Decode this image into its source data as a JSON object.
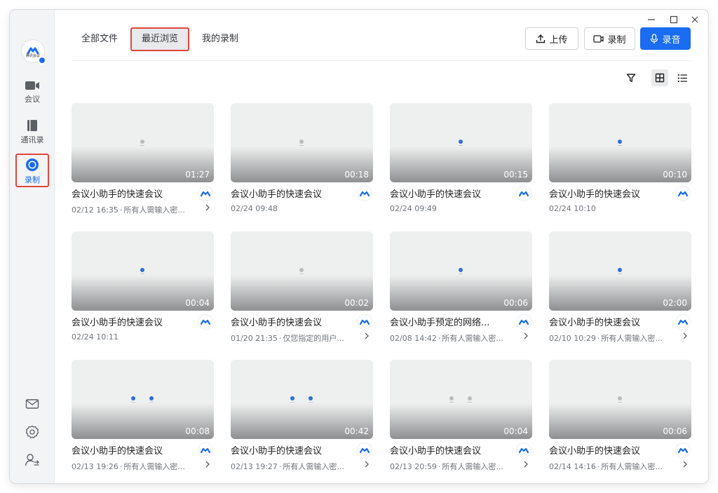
{
  "sidebar": {
    "logo_text": "腾讯会议",
    "items": [
      {
        "label": "会议",
        "icon": "video-camera-icon"
      },
      {
        "label": "通讯录",
        "icon": "contacts-book-icon"
      },
      {
        "label": "录制",
        "icon": "record-circle-icon",
        "active": true
      }
    ],
    "bottom": [
      "mail-icon",
      "settings-gear-icon",
      "user-switch-icon"
    ]
  },
  "tabs": [
    {
      "label": "全部文件"
    },
    {
      "label": "最近浏览",
      "active": true
    },
    {
      "label": "我的录制"
    }
  ],
  "header_buttons": {
    "upload": "上传",
    "record": "录制",
    "audio": "录音"
  },
  "toolbar": {
    "filter": "filter-icon",
    "grid_view": "grid-view-icon",
    "list_view": "list-view-icon",
    "selected_view": "grid"
  },
  "recordings": [
    {
      "title": "会议小助手的快速会议",
      "duration": "01:27",
      "time": "02/12 16:35",
      "note": "所有人需输入密...",
      "thumb": [
        "gray"
      ]
    },
    {
      "title": "会议小助手的快速会议",
      "duration": "00:18",
      "time": "02/24 09:48",
      "note": "",
      "thumb": [
        "gray"
      ]
    },
    {
      "title": "会议小助手的快速会议",
      "duration": "00:15",
      "time": "02/24 09:49",
      "note": "",
      "thumb": [
        "blue"
      ]
    },
    {
      "title": "会议小助手的快速会议",
      "duration": "00:10",
      "time": "02/24 10:10",
      "note": "",
      "thumb": [
        "blue"
      ]
    },
    {
      "title": "会议小助手的快速会议",
      "duration": "00:04",
      "time": "02/24 10:11",
      "note": "",
      "thumb": [
        "blue"
      ]
    },
    {
      "title": "会议小助手的快速会议",
      "duration": "00:02",
      "time": "01/20 21:35",
      "note": "仅您指定的用户...",
      "thumb": [
        "gray"
      ]
    },
    {
      "title": "会议小助手预定的网络...",
      "duration": "00:06",
      "time": "02/08 14:42",
      "note": "所有人需输入密...",
      "thumb": [
        "blue"
      ]
    },
    {
      "title": "会议小助手的快速会议",
      "duration": "02:00",
      "time": "02/10 10:29",
      "note": "所有人需输入密...",
      "thumb": [
        "blue"
      ]
    },
    {
      "title": "会议小助手的快速会议",
      "duration": "00:08",
      "time": "02/13 19:26",
      "note": "所有人需输入密...",
      "thumb": [
        "blue",
        "blue"
      ]
    },
    {
      "title": "会议小助手的快速会议",
      "duration": "00:42",
      "time": "02/13 19:27",
      "note": "所有人需输入密...",
      "thumb": [
        "blue",
        "blue"
      ]
    },
    {
      "title": "会议小助手的快速会议",
      "duration": "00:04",
      "time": "02/13 20:59",
      "note": "所有人需输入密...",
      "thumb": [
        "gray",
        "gray"
      ]
    },
    {
      "title": "会议小助手的快速会议",
      "duration": "00:06",
      "time": "02/14 14:16",
      "note": "所有人需输入密...",
      "thumb": [
        "gray"
      ]
    }
  ],
  "colors": {
    "accent": "#1a6cf0",
    "highlight": "#e0473c"
  }
}
